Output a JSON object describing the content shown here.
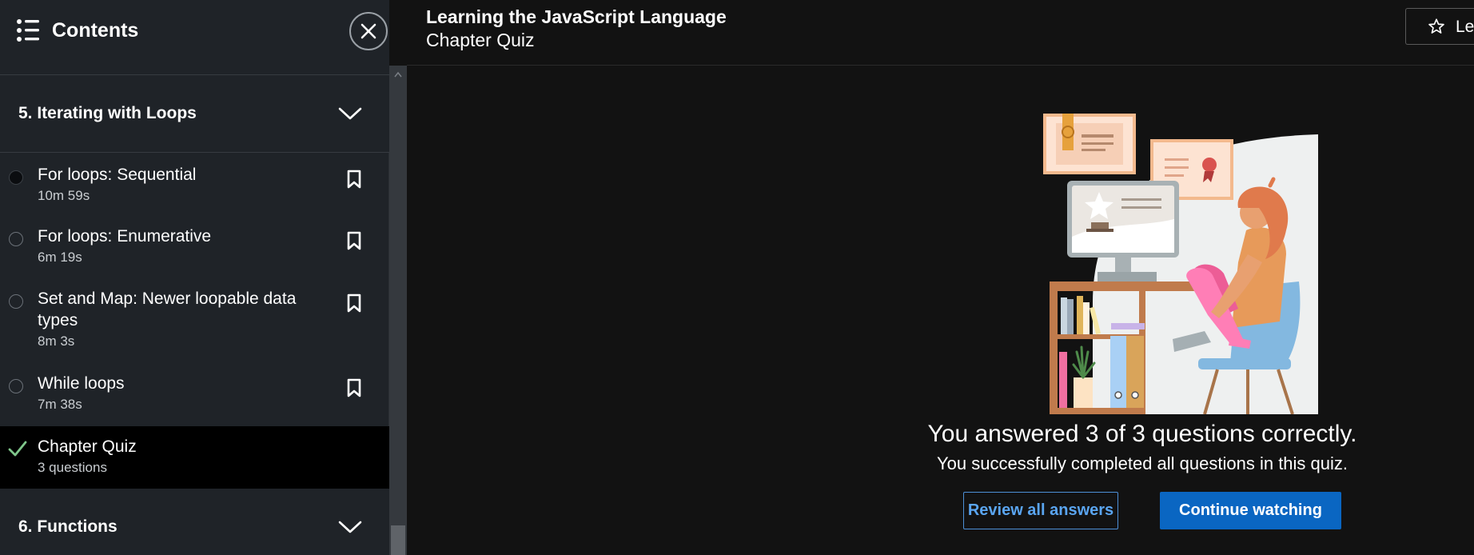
{
  "sidebar": {
    "title": "Contents",
    "sections": [
      {
        "title": "5. Iterating with Loops",
        "items": [
          {
            "title": "For loops: Sequential",
            "meta": "10m 59s",
            "status": "in-progress"
          },
          {
            "title": "For loops: Enumerative",
            "meta": "6m 19s",
            "status": "not-started"
          },
          {
            "title": "Set and Map: Newer loopable data types",
            "meta": "8m 3s",
            "status": "not-started"
          },
          {
            "title": "While loops",
            "meta": "7m 38s",
            "status": "not-started"
          },
          {
            "title": "Chapter Quiz",
            "meta": "3 questions",
            "status": "completed",
            "active": true
          }
        ]
      },
      {
        "title": "6. Functions"
      }
    ]
  },
  "header": {
    "course_title": "Learning the JavaScript Language",
    "chapter_title": "Chapter Quiz",
    "action_label": "Lea"
  },
  "main": {
    "result": "You answered 3 of 3 questions correctly.",
    "subtitle": "You successfully completed all questions in this quiz.",
    "review_label": "Review all answers",
    "continue_label": "Continue watching"
  },
  "colors": {
    "primary": "#0a66c2",
    "link": "#5aa5f0",
    "success": "#7fc68b",
    "sidebar_bg": "#1f2328",
    "active_bg": "#000000"
  },
  "icons": [
    "list-icon",
    "close-icon",
    "chevron-down-icon",
    "bookmark-icon",
    "check-icon",
    "star-icon"
  ]
}
